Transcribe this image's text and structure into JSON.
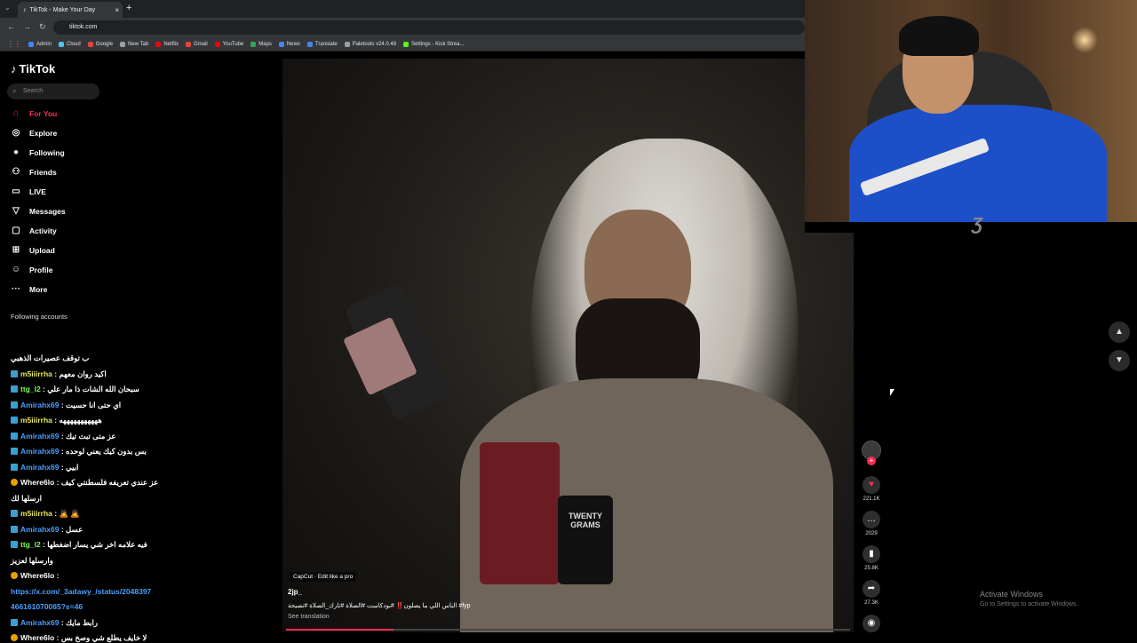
{
  "browser": {
    "tab_title": "TikTok - Make Your Day",
    "new_tab_symbol": "+",
    "url": "tiktok.com",
    "bookmarks": [
      {
        "label": "Admin",
        "color": "#4285f4"
      },
      {
        "label": "Cloud",
        "color": "#4fc3f7"
      },
      {
        "label": "Google",
        "color": "#ea4335"
      },
      {
        "label": "New Tab",
        "color": "#9aa0a6"
      },
      {
        "label": "Netflix",
        "color": "#e50914"
      },
      {
        "label": "Gmail",
        "color": "#ea4335"
      },
      {
        "label": "YouTube",
        "color": "#ff0000"
      },
      {
        "label": "Maps",
        "color": "#34a853"
      },
      {
        "label": "News",
        "color": "#4285f4"
      },
      {
        "label": "Translate",
        "color": "#4285f4"
      },
      {
        "label": "Paletools v24.0.48",
        "color": "#9aa0a6"
      },
      {
        "label": "Settings - Kick Strea...",
        "color": "#53fc18"
      }
    ]
  },
  "sidebar": {
    "logo": "TikTok",
    "search_placeholder": "Search",
    "nav": [
      {
        "label": "For You",
        "icon": "home-icon",
        "active": true
      },
      {
        "label": "Explore",
        "icon": "compass-icon"
      },
      {
        "label": "Following",
        "icon": "following-avatar-icon"
      },
      {
        "label": "Friends",
        "icon": "friends-icon"
      },
      {
        "label": "LIVE",
        "icon": "live-icon"
      },
      {
        "label": "Messages",
        "icon": "messages-icon"
      },
      {
        "label": "Activity",
        "icon": "activity-icon"
      },
      {
        "label": "Upload",
        "icon": "upload-icon"
      },
      {
        "label": "Profile",
        "icon": "profile-icon"
      },
      {
        "label": "More",
        "icon": "more-icon"
      }
    ],
    "following_title": "Following accounts"
  },
  "chat": [
    {
      "user": "",
      "msg": "ب توقف عصيرات الذهبي",
      "style": "white"
    },
    {
      "user": "m5iiirrha",
      "msg": ": اكيد روان معهم",
      "style": "yellow"
    },
    {
      "user": "ttg_l2",
      "msg": ": سبحان الله الشات ذا مار علي",
      "style": "green"
    },
    {
      "user": "Amirahx69",
      "msg": ": اي حتى انا حسيت",
      "style": "blue"
    },
    {
      "user": "m5iiirrha",
      "msg": ": هههههههههههه",
      "style": "yellow"
    },
    {
      "user": "Amirahx69",
      "msg": ": عز متى تبث تيك",
      "style": "blue"
    },
    {
      "user": "Amirahx69",
      "msg": ": بس بدون كيك يعني لوحده",
      "style": "blue"
    },
    {
      "user": "Amirahx69",
      "msg": ": ابيي",
      "style": "blue"
    },
    {
      "user": "Where6lo",
      "msg": ": عز عندي تعريفه فلسطنتي كيف",
      "style": "white"
    },
    {
      "user": "",
      "msg": "ارسلها لك",
      "style": "white"
    },
    {
      "user": "m5iiirrha",
      "msg": ": 🙇 🙇",
      "style": "yellow"
    },
    {
      "user": "Amirahx69",
      "msg": ": عسل",
      "style": "blue"
    },
    {
      "user": "ttg_l2",
      "msg": ": فيه علامه اخر شي يسار اضغطها",
      "style": "green"
    },
    {
      "user": "",
      "msg": "وارسلها لعزيز",
      "style": "white"
    },
    {
      "user": "Where6lo",
      "msg": ":",
      "style": "white"
    },
    {
      "user": "",
      "msg": "https://x.com/_3adawy_/status/2048397",
      "style": "link"
    },
    {
      "user": "",
      "msg": "466161070085?s=46",
      "style": "link"
    },
    {
      "user": "Amirahx69",
      "msg": ": رابط مايك",
      "style": "blue"
    },
    {
      "user": "Where6lo",
      "msg": ": لا خايف يطلع شي وصخ بس",
      "style": "white"
    }
  ],
  "video": {
    "capcut": "CapCut · Edit like a pro",
    "author": "2jp_",
    "description": "الناس اللي ما يصلون‼️ #بودكاست #الصلاة #تارك_الصلاة #نصيحة #fyp",
    "see_translation": "See translation",
    "can_text": "TWENTY GRAMS",
    "progress": 0.19
  },
  "actions": {
    "likes": "221.1K",
    "comments": "2029",
    "saves": "25.8K",
    "shares": "27.3K"
  },
  "overlay": {
    "activate_title": "Activate Windows",
    "activate_sub": "Go to Settings to activate Windows."
  }
}
